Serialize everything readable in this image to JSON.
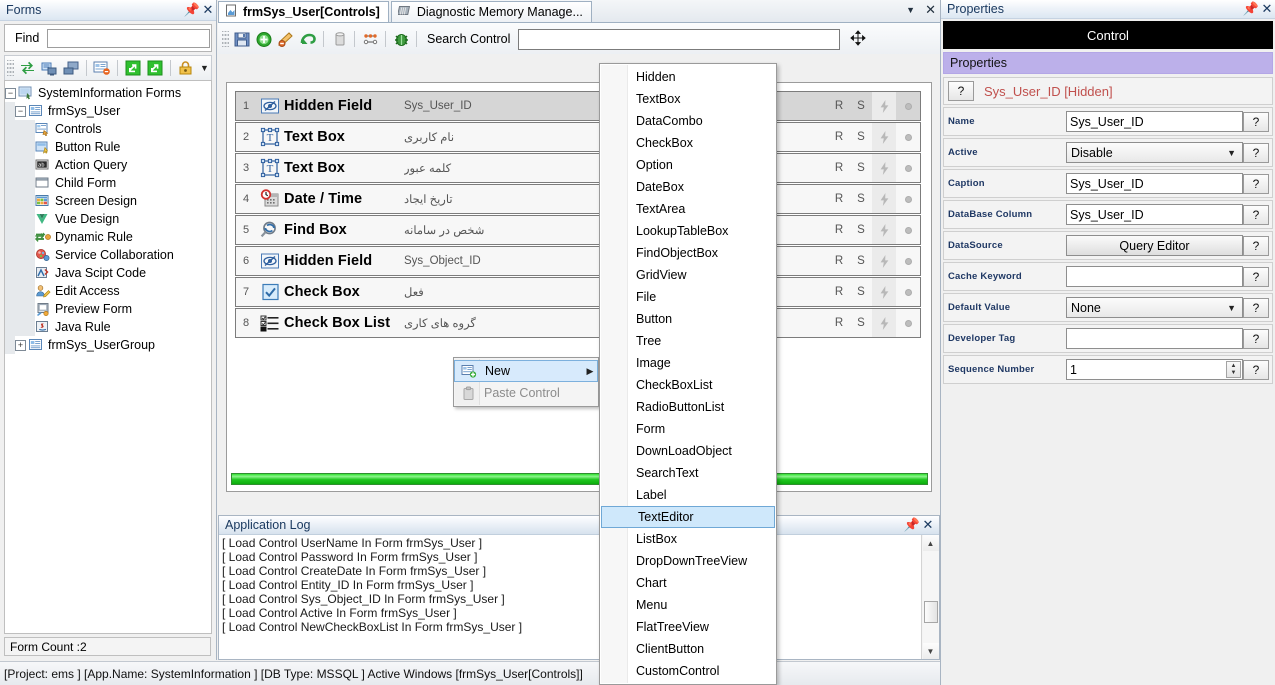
{
  "forms_panel": {
    "title": "Forms",
    "pin_icon": "pin-icon",
    "close_icon": "close-icon",
    "find_label": "Find",
    "find_value": "",
    "find_placeholder": "",
    "toolbar_icons": [
      "refresh-icon",
      "new-form-icon",
      "remove-form-icon",
      "form-properties-icon",
      "export-icon",
      "import-icon",
      "lock-icon",
      "overflow-icon"
    ],
    "tree": [
      {
        "label": "SystemInformation Forms",
        "depth": 0,
        "expander": "minus",
        "icon": "forms-root-icon"
      },
      {
        "label": "frmSys_User",
        "depth": 1,
        "expander": "minus",
        "icon": "form-icon"
      },
      {
        "label": "Controls",
        "depth": 2,
        "expander": "none",
        "icon": "controls-icon"
      },
      {
        "label": "Button Rule",
        "depth": 2,
        "expander": "none",
        "icon": "button-rule-icon"
      },
      {
        "label": "Action Query",
        "depth": 2,
        "expander": "none",
        "icon": "action-query-icon"
      },
      {
        "label": "Child Form",
        "depth": 2,
        "expander": "none",
        "icon": "child-form-icon"
      },
      {
        "label": "Screen Design",
        "depth": 2,
        "expander": "none",
        "icon": "screen-design-icon"
      },
      {
        "label": "Vue Design",
        "depth": 2,
        "expander": "none",
        "icon": "vue-design-icon"
      },
      {
        "label": "Dynamic Rule",
        "depth": 2,
        "expander": "none",
        "icon": "dynamic-rule-icon"
      },
      {
        "label": "Service Collaboration",
        "depth": 2,
        "expander": "none",
        "icon": "service-collaboration-icon"
      },
      {
        "label": "Java Scipt Code",
        "depth": 2,
        "expander": "none",
        "icon": "javascript-code-icon"
      },
      {
        "label": "Edit Access",
        "depth": 2,
        "expander": "none",
        "icon": "edit-access-icon"
      },
      {
        "label": "Preview Form",
        "depth": 2,
        "expander": "none",
        "icon": "preview-form-icon"
      },
      {
        "label": "Java Rule",
        "depth": 2,
        "expander": "none",
        "icon": "java-rule-icon"
      },
      {
        "label": "frmSys_UserGroup",
        "depth": 1,
        "expander": "plus",
        "icon": "form-icon"
      }
    ],
    "form_count": "Form Count :2"
  },
  "tabs": {
    "items": [
      {
        "label": "frmSys_User[Controls]",
        "icon": "form-tab-icon",
        "active": true
      },
      {
        "label": "Diagnostic Memory Manage...",
        "icon": "memory-tab-icon",
        "active": false
      }
    ],
    "dropdown_icon": "chevron-down-icon",
    "close_icon": "close-icon"
  },
  "toolbar": {
    "icons": [
      "save-icon",
      "add-icon",
      "edit-icon",
      "undo-icon",
      "database-icon",
      "nodes-icon",
      "bug-icon"
    ],
    "search_label": "Search Control",
    "search_value": "",
    "search_placeholder": "",
    "move_icon": "move-icon"
  },
  "designer": {
    "columns": {
      "r": "R",
      "s": "S"
    },
    "rows": [
      {
        "num": "1",
        "icon": "hidden-field-icon",
        "name": "Hidden Field",
        "caption": "Sys_User_ID",
        "selected": true
      },
      {
        "num": "2",
        "icon": "textbox-icon",
        "name": "Text Box",
        "caption": "نام کاربری",
        "selected": false
      },
      {
        "num": "3",
        "icon": "textbox-icon",
        "name": "Text Box",
        "caption": "کلمه عبور",
        "selected": false
      },
      {
        "num": "4",
        "icon": "datetime-icon",
        "name": "Date / Time",
        "caption": "تاریخ ایجاد",
        "selected": false
      },
      {
        "num": "5",
        "icon": "findbox-icon",
        "name": "Find Box",
        "caption": "شخص در سامانه",
        "selected": false
      },
      {
        "num": "6",
        "icon": "hidden-field-icon",
        "name": "Hidden Field",
        "caption": "Sys_Object_ID",
        "selected": false
      },
      {
        "num": "7",
        "icon": "checkbox-icon",
        "name": "Check Box",
        "caption": "فعل",
        "selected": false
      },
      {
        "num": "8",
        "icon": "checkboxlist-icon",
        "name": "Check Box List",
        "caption": "گروه های کاری",
        "selected": false
      }
    ]
  },
  "context_menu": {
    "items": [
      {
        "label": "New",
        "icon": "new-control-icon",
        "highlighted": true,
        "has_submenu": true,
        "disabled": false
      },
      {
        "label": "Paste Control",
        "icon": "paste-icon",
        "highlighted": false,
        "has_submenu": false,
        "disabled": true
      }
    ]
  },
  "submenu": {
    "items": [
      {
        "label": "Hidden",
        "selected": false
      },
      {
        "label": "TextBox",
        "selected": false
      },
      {
        "label": "DataCombo",
        "selected": false
      },
      {
        "label": "CheckBox",
        "selected": false
      },
      {
        "label": "Option",
        "selected": false
      },
      {
        "label": "DateBox",
        "selected": false
      },
      {
        "label": "TextArea",
        "selected": false
      },
      {
        "label": "LookupTableBox",
        "selected": false
      },
      {
        "label": "FindObjectBox",
        "selected": false
      },
      {
        "label": "GridView",
        "selected": false
      },
      {
        "label": "File",
        "selected": false
      },
      {
        "label": "Button",
        "selected": false
      },
      {
        "label": "Tree",
        "selected": false
      },
      {
        "label": "Image",
        "selected": false
      },
      {
        "label": "CheckBoxList",
        "selected": false
      },
      {
        "label": "RadioButtonList",
        "selected": false
      },
      {
        "label": "Form",
        "selected": false
      },
      {
        "label": "DownLoadObject",
        "selected": false
      },
      {
        "label": "SearchText",
        "selected": false
      },
      {
        "label": "Label",
        "selected": false
      },
      {
        "label": "TextEditor",
        "selected": true
      },
      {
        "label": "ListBox",
        "selected": false
      },
      {
        "label": "DropDownTreeView",
        "selected": false
      },
      {
        "label": "Chart",
        "selected": false
      },
      {
        "label": "Menu",
        "selected": false
      },
      {
        "label": "FlatTreeView",
        "selected": false
      },
      {
        "label": "ClientButton",
        "selected": false
      },
      {
        "label": "CustomControl",
        "selected": false
      }
    ]
  },
  "log_panel": {
    "title": "Application Log",
    "pin_icon": "pin-icon",
    "close_icon": "close-icon",
    "lines": [
      "[ Load Control UserName In  Form frmSys_User ]",
      "[ Load Control Password In  Form frmSys_User ]",
      "[ Load Control CreateDate In  Form frmSys_User ]",
      "[ Load Control Entity_ID In  Form frmSys_User ]",
      "[ Load Control Sys_Object_ID In  Form frmSys_User ]",
      "[ Load Control Active In  Form frmSys_User ]",
      "[ Load Control NewCheckBoxList In  Form frmSys_User ]"
    ]
  },
  "properties_panel": {
    "title": "Properties",
    "pin_icon": "pin-icon",
    "close_icon": "close-icon",
    "control_header": "Control",
    "section_header": "Properties",
    "object_name": "Sys_User_ID [Hidden]",
    "help_label": "?",
    "rows": [
      {
        "label": "Name",
        "type": "text",
        "value": "Sys_User_ID"
      },
      {
        "label": "Active",
        "type": "select",
        "value": "Disable"
      },
      {
        "label": "Caption",
        "type": "text",
        "value": "Sys_User_ID"
      },
      {
        "label": "DataBase Column",
        "type": "text",
        "value": "Sys_User_ID"
      },
      {
        "label": "DataSource",
        "type": "button",
        "value": "Query Editor"
      },
      {
        "label": "Cache Keyword",
        "type": "text",
        "value": ""
      },
      {
        "label": "Default Value",
        "type": "select",
        "value": "None"
      },
      {
        "label": "Developer Tag",
        "type": "text",
        "value": ""
      },
      {
        "label": "Sequence Number",
        "type": "spin",
        "value": "1"
      }
    ]
  },
  "statusbar": {
    "text": "[Project: ems ] [App.Name: SystemInformation ] [DB Type: MSSQL ]   Active Windows [frmSys_User[Controls]]"
  },
  "colors": {
    "accent_purple": "#bcb0ea",
    "selection_blue": "#cfe8fb",
    "progress_green": "#21c821",
    "object_name_red": "#c0504d"
  }
}
